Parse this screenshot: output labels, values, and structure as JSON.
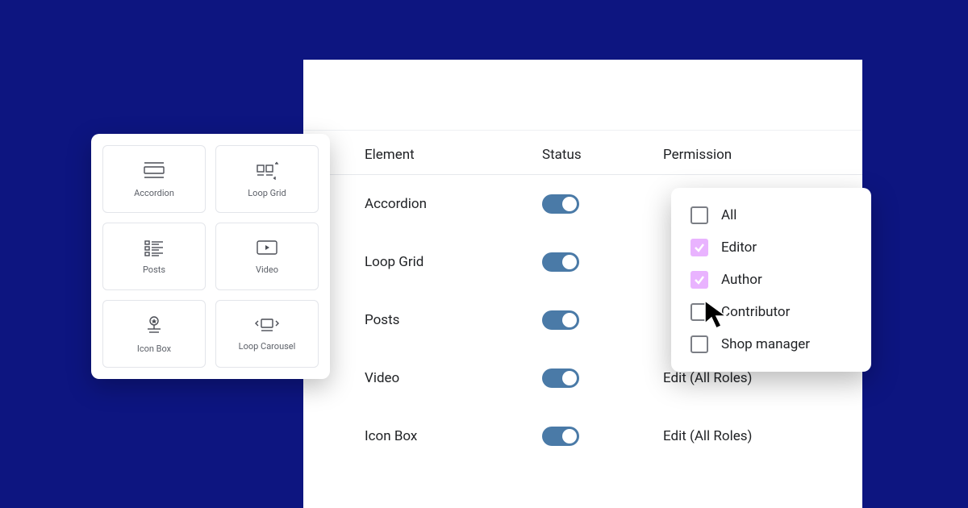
{
  "colors": {
    "background": "#0d1580",
    "toggle_on": "#4a7aa7",
    "checkbox_checked": "#e9b3ff"
  },
  "widgets": [
    {
      "id": "accordion",
      "label": "Accordion",
      "icon": "accordion-icon"
    },
    {
      "id": "loop-grid",
      "label": "Loop Grid",
      "icon": "loop-grid-icon"
    },
    {
      "id": "posts",
      "label": "Posts",
      "icon": "posts-icon"
    },
    {
      "id": "video",
      "label": "Video",
      "icon": "video-icon"
    },
    {
      "id": "icon-box",
      "label": "Icon Box",
      "icon": "icon-box-icon"
    },
    {
      "id": "loop-carousel",
      "label": "Loop Carousel",
      "icon": "loop-carousel-icon"
    }
  ],
  "table": {
    "headers": {
      "element": "Element",
      "status": "Status",
      "permission": "Permission"
    },
    "rows": [
      {
        "element": "Accordion",
        "status": true,
        "permission": ""
      },
      {
        "element": "Loop Grid",
        "status": true,
        "permission": ""
      },
      {
        "element": "Posts",
        "status": true,
        "permission": ""
      },
      {
        "element": "Video",
        "status": true,
        "permission": "Edit (All Roles)"
      },
      {
        "element": "Icon Box",
        "status": true,
        "permission": "Edit (All Roles)"
      }
    ]
  },
  "permission_dropdown": {
    "options": [
      {
        "label": "All",
        "checked": false
      },
      {
        "label": "Editor",
        "checked": true
      },
      {
        "label": "Author",
        "checked": true
      },
      {
        "label": "Contributor",
        "checked": false
      },
      {
        "label": "Shop manager",
        "checked": false
      }
    ]
  }
}
